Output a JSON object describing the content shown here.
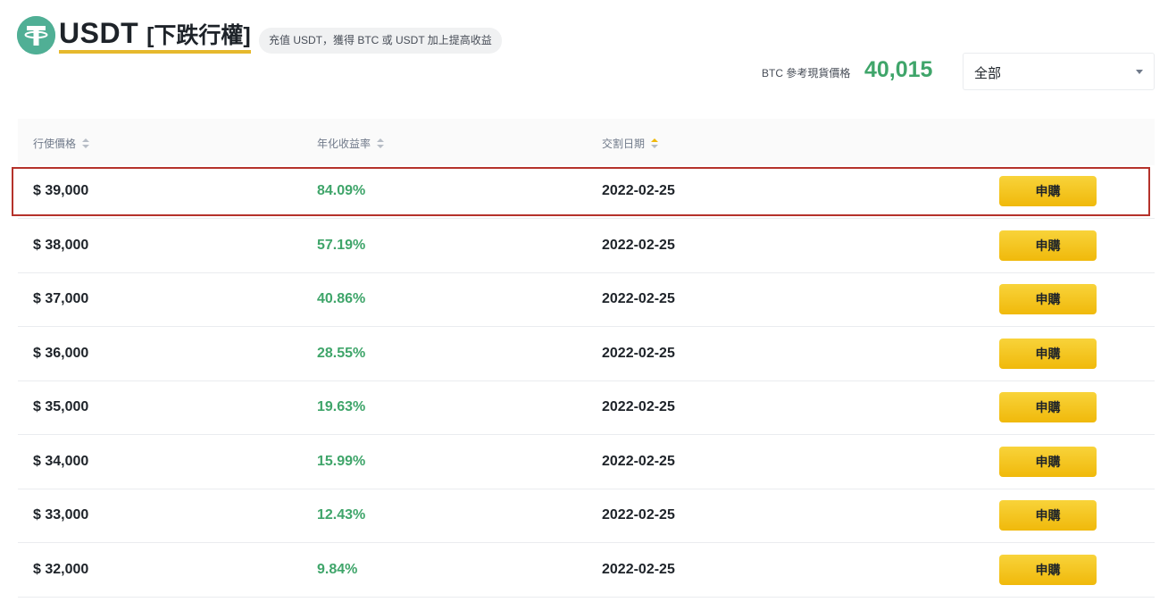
{
  "header": {
    "coin": "USDT",
    "type_label": "[下跌行權]",
    "promo_text": "充值 USDT，獲得 BTC 或 USDT 加上提高收益",
    "ref_price_label": "BTC 參考現貨價格",
    "ref_price_value": "40,015",
    "filter_selected": "全部",
    "accent_color": "#e6b92d",
    "positive_color": "#3fa56a"
  },
  "table": {
    "columns": [
      {
        "label": "行使價格",
        "sort": "none"
      },
      {
        "label": "年化收益率",
        "sort": "none"
      },
      {
        "label": "交割日期",
        "sort": "ascending"
      }
    ],
    "action_label": "申購",
    "rows": [
      {
        "price": "$ 39,000",
        "apy": "84.09%",
        "date": "2022-02-25"
      },
      {
        "price": "$ 38,000",
        "apy": "57.19%",
        "date": "2022-02-25"
      },
      {
        "price": "$ 37,000",
        "apy": "40.86%",
        "date": "2022-02-25"
      },
      {
        "price": "$ 36,000",
        "apy": "28.55%",
        "date": "2022-02-25"
      },
      {
        "price": "$ 35,000",
        "apy": "19.63%",
        "date": "2022-02-25"
      },
      {
        "price": "$ 34,000",
        "apy": "15.99%",
        "date": "2022-02-25"
      },
      {
        "price": "$ 33,000",
        "apy": "12.43%",
        "date": "2022-02-25"
      },
      {
        "price": "$ 32,000",
        "apy": "9.84%",
        "date": "2022-02-25"
      }
    ],
    "highlighted_row": 0,
    "highlight_color": "#b5322b"
  },
  "icons": {
    "coin_logo": "tether-logo-icon",
    "sort": "sort-arrows-icon",
    "dropdown": "chevron-down-icon"
  }
}
